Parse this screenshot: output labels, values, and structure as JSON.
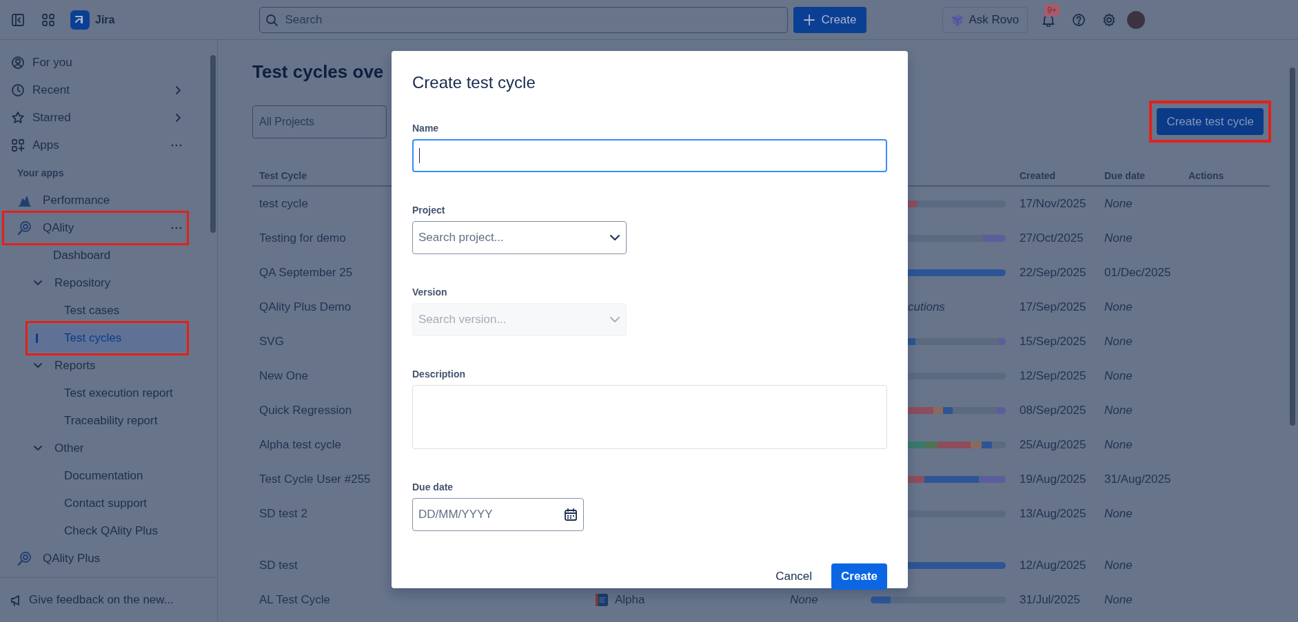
{
  "topbar": {
    "product": "Jira",
    "search": {
      "placeholder": "Search"
    },
    "create_button": "Create",
    "rovo_button": "Ask Rovo",
    "notifications_badge": "9+"
  },
  "sidebar": {
    "items": [
      {
        "kind": "nav",
        "label": "For you",
        "submenu": false,
        "more": false,
        "highlighted": false
      },
      {
        "kind": "nav",
        "label": "Recent",
        "submenu": true,
        "more": false,
        "highlighted": false
      },
      {
        "kind": "nav",
        "label": "Starred",
        "submenu": true,
        "more": false,
        "highlighted": false
      },
      {
        "kind": "nav",
        "label": "Apps",
        "submenu": false,
        "more": true,
        "highlighted": false
      },
      {
        "kind": "heading",
        "label": "Your apps"
      },
      {
        "kind": "app",
        "label": "Performance",
        "more": false,
        "highlighted": false
      },
      {
        "kind": "app",
        "label": "QAlity",
        "more": true,
        "highlighted": true,
        "children": [
          {
            "kind": "link",
            "label": "Dashboard",
            "selected": false,
            "highlighted": false
          },
          {
            "kind": "group",
            "label": "Repository",
            "expanded": true,
            "highlighted": false,
            "children": [
              {
                "kind": "link",
                "label": "Test cases",
                "selected": false,
                "highlighted": false
              },
              {
                "kind": "link",
                "label": "Test cycles",
                "selected": true,
                "highlighted": true
              }
            ]
          },
          {
            "kind": "group",
            "label": "Reports",
            "expanded": true,
            "highlighted": false,
            "children": [
              {
                "kind": "link",
                "label": "Test execution report",
                "selected": false,
                "highlighted": false
              },
              {
                "kind": "link",
                "label": "Traceability report",
                "selected": false,
                "highlighted": false
              }
            ]
          },
          {
            "kind": "group",
            "label": "Other",
            "expanded": true,
            "highlighted": false,
            "children": [
              {
                "kind": "link",
                "label": "Documentation",
                "selected": false,
                "highlighted": false
              },
              {
                "kind": "link",
                "label": "Contact support",
                "selected": false,
                "highlighted": false
              },
              {
                "kind": "link",
                "label": "Check QAlity Plus",
                "selected": false,
                "highlighted": false
              }
            ]
          }
        ]
      },
      {
        "kind": "app",
        "label": "QAlity Plus",
        "more": false,
        "highlighted": false
      }
    ],
    "footer": "Give feedback on the new..."
  },
  "main": {
    "title": "Test cycles ove",
    "project_filter": "All Projects",
    "create_button": {
      "label": "Create test cycle",
      "highlighted": true
    },
    "table": {
      "columns": {
        "test_cycle": "Test Cycle",
        "created": "Created",
        "due_date": "Due date",
        "actions": "Actions"
      },
      "rows": [
        {
          "name": "test cycle",
          "created": "17/Nov/2025",
          "due": {
            "text": "None",
            "empty": true
          }
        },
        {
          "name": "Testing for demo",
          "created": "27/Oct/2025",
          "due": {
            "text": "None",
            "empty": true
          }
        },
        {
          "name": "QA September 25",
          "created": "22/Sep/2025",
          "due": {
            "text": "01/Dec/2025",
            "empty": false
          }
        },
        {
          "name": "QAlity Plus Demo",
          "progress_note": "cutions",
          "created": "17/Sep/2025",
          "due": {
            "text": "None",
            "empty": true
          }
        },
        {
          "name": "SVG",
          "created": "15/Sep/2025",
          "due": {
            "text": "None",
            "empty": true
          }
        },
        {
          "name": "New One",
          "created": "12/Sep/2025",
          "due": {
            "text": "None",
            "empty": true
          }
        },
        {
          "name": "Quick Regression",
          "created": "08/Sep/2025",
          "due": {
            "text": "None",
            "empty": true
          }
        },
        {
          "name": "Alpha test cycle",
          "created": "25/Aug/2025",
          "due": {
            "text": "None",
            "empty": true
          }
        },
        {
          "name": "Test Cycle User #255",
          "created": "19/Aug/2025",
          "due": {
            "text": "31/Aug/2025",
            "empty": false
          }
        },
        {
          "name": "SD test 2",
          "created": "13/Aug/2025",
          "due": {
            "text": "None",
            "empty": true
          }
        },
        {
          "name": "SD test",
          "created": "12/Aug/2025",
          "due": {
            "text": "None",
            "empty": true
          }
        },
        {
          "name": "AL Test Cycle",
          "project": "Alpha",
          "version": {
            "text": "None",
            "empty": true
          },
          "created": "31/Jul/2025",
          "due": {
            "text": "None",
            "empty": true
          }
        }
      ]
    }
  },
  "modal": {
    "title": "Create test cycle",
    "fields": [
      {
        "kind": "text",
        "label": "Name",
        "focused": true
      },
      {
        "kind": "select",
        "label": "Project",
        "placeholder": "Search project...",
        "disabled": false
      },
      {
        "kind": "select",
        "label": "Version",
        "placeholder": "Search version...",
        "disabled": true
      },
      {
        "kind": "textarea",
        "label": "Description"
      },
      {
        "kind": "date",
        "label": "Due date",
        "placeholder": "DD/MM/YYYY"
      }
    ],
    "buttons": [
      {
        "kind": "subtle",
        "label": "Cancel"
      },
      {
        "kind": "primary",
        "label": "Create"
      }
    ]
  }
}
